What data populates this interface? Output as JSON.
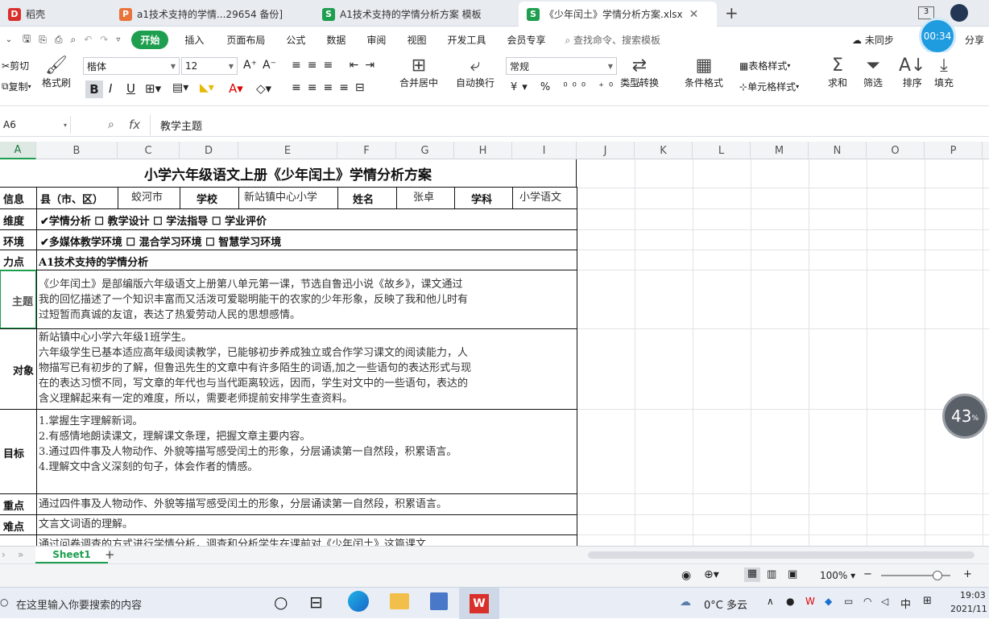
{
  "tabs": [
    {
      "label": "稻壳",
      "color": "#d9302c",
      "glyph": "D"
    },
    {
      "label": "a1技术支持的学情...29654 备份]",
      "color": "#e8743b",
      "glyph": "P"
    },
    {
      "label": "A1技术支持的学情分析方案 模板",
      "color": "#1e9e4f",
      "glyph": "S"
    },
    {
      "label": "《少年闰土》学情分析方案.xlsx",
      "color": "#1e9e4f",
      "glyph": "S"
    }
  ],
  "tab_add": "+",
  "window_badge": "3",
  "menu": {
    "items": [
      "开始",
      "插入",
      "页面布局",
      "公式",
      "数据",
      "审阅",
      "视图",
      "开发工具",
      "会员专享"
    ],
    "search": "查找命令、搜索模板",
    "sync": "未同步",
    "share": "分享",
    "timer": "00:34"
  },
  "ribbon": {
    "cut": "剪切",
    "copy": "复制",
    "format_painter": "格式刷",
    "font": "楷体",
    "size": "12",
    "merge": "合并居中",
    "wrap": "自动换行",
    "numfmt": "常规",
    "type_convert": "类型转换",
    "cond_format": "条件格式",
    "table_style": "表格样式",
    "cell_style": "单元格样式",
    "sum": "求和",
    "filter": "筛选",
    "sort": "排序",
    "fill": "填充"
  },
  "formula": {
    "namebox": "A6",
    "fx": "fx",
    "value": "教学主题"
  },
  "columns": [
    "A",
    "B",
    "C",
    "D",
    "E",
    "F",
    "G",
    "H",
    "I",
    "J",
    "K",
    "L",
    "M",
    "N",
    "O",
    "P"
  ],
  "sheet": {
    "title": "小学六年级语文上册《少年闰土》学情分析方案",
    "row_info": {
      "label": "信息",
      "county": "县（市、区）",
      "county_val": "蛟河市",
      "school": "学校",
      "school_val": "新站镇中心小学",
      "name": "姓名",
      "name_val": "张卓",
      "subject": "学科",
      "subject_val": "小学语文"
    },
    "row_dim": {
      "label": "维度",
      "text": "✔学情分析 ☐ 教学设计 ☐ 学法指导 ☐ 学业评价"
    },
    "row_env": {
      "label": "环境",
      "text": "✔多媒体教学环境 ☐ 混合学习环境 ☐ 智慧学习环境"
    },
    "row_ability": {
      "label": "力点",
      "text": "A1技术支持的学情分析"
    },
    "row_topic": {
      "label": "主题",
      "lines": [
        "《少年闰土》是部编版六年级语文上册第八单元第一课，节选自鲁迅小说《故乡》，课文通过",
        "我的回忆描述了一个知识丰富而又活泼可爱聪明能干的农家的少年形象，反映了我和他儿时有",
        "过短暂而真诚的友谊，表达了热爱劳动人民的思想感情。"
      ]
    },
    "row_object": {
      "label": "对象",
      "lines": [
        "新站镇中心小学六年级1班学生。",
        "六年级学生已基本适应高年级阅读教学，已能够初步养成独立或合作学习课文的阅读能力，人",
        "物描写已有初步的了解，但鲁迅先生的文章中有许多陌生的词语,加之一些语句的表达形式与现",
        "在的表达习惯不同，写文章的年代也与当代距离较远，因而，学生对文中的一些语句，表达的",
        "含义理解起来有一定的难度，所以，需要老师提前安排学生查资料。"
      ]
    },
    "row_goal": {
      "label": "目标",
      "lines": [
        "1.掌握生字理解新词。",
        "2.有感情地朗读课文，理解课文条理，把握文章主要内容。",
        "3.通过四件事及人物动作、外貌等描写感受闰土的形象，分层诵读第一自然段，积累语言。",
        "4.理解文中含义深刻的句子，体会作者的情感。"
      ]
    },
    "row_key": {
      "label": "重点",
      "text": "通过四件事及人物动作、外貌等描写感受闰土的形象，分层诵读第一自然段，积累语言。"
    },
    "row_diff": {
      "label": "难点",
      "text": "文言文词语的理解。"
    },
    "row_next": {
      "text": "通过问卷调查的方式进行学情分析，调查和分析学生在课前对《少年闰土》这篇课文"
    }
  },
  "sheet_tab": "Sheet1",
  "zoom": "100%",
  "progress_badge": "43",
  "taskbar": {
    "search": "在这里输入你要搜索的内容",
    "weather": "0°C 多云",
    "ime": "中",
    "time": "19:03",
    "date": "2021/11"
  }
}
